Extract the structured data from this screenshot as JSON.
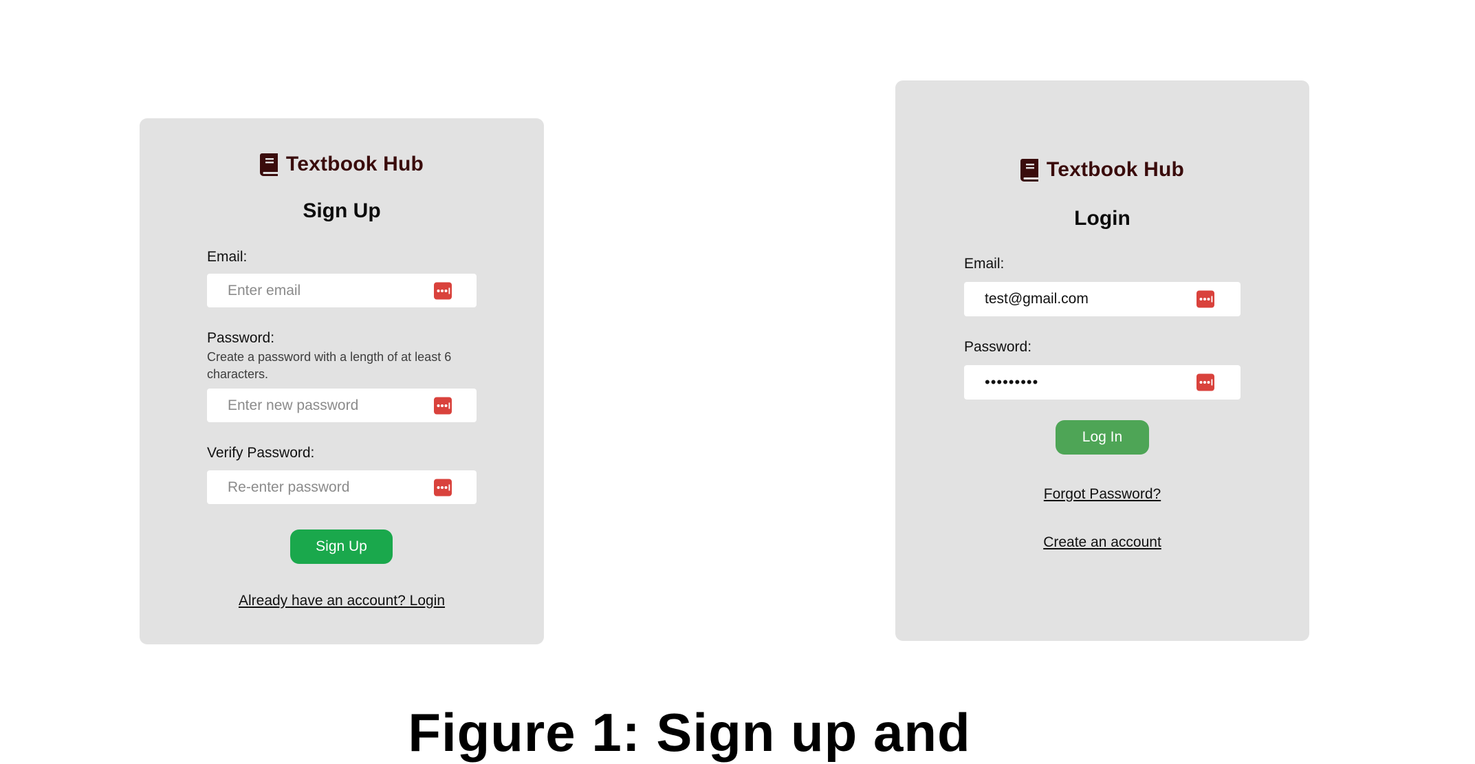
{
  "signup": {
    "brand": "Textbook Hub",
    "heading": "Sign Up",
    "email_label": "Email:",
    "email_placeholder": "Enter email",
    "password_label": "Password:",
    "password_hint": "Create a password with a length of at least 6 characters.",
    "password_placeholder": "Enter new password",
    "verify_label": "Verify Password:",
    "verify_placeholder": "Re-enter password",
    "submit_label": "Sign Up",
    "login_link": "Already have an account? Login"
  },
  "login": {
    "brand": "Textbook Hub",
    "heading": "Login",
    "email_label": "Email:",
    "email_value": "test@gmail.com",
    "password_label": "Password:",
    "password_value": "•••••••••",
    "submit_label": "Log In",
    "forgot_link": "Forgot Password?",
    "create_link": "Create an account"
  },
  "caption": "Figure 1: Sign up and",
  "icons": {
    "brand": "book-icon",
    "field": "password-manager-icon"
  },
  "colors": {
    "card_bg": "#e2e2e2",
    "brand_text": "#3a0c0c",
    "signup_button": "#1aa84c",
    "login_button": "#4ea556",
    "field_icon": "#d9423c"
  }
}
